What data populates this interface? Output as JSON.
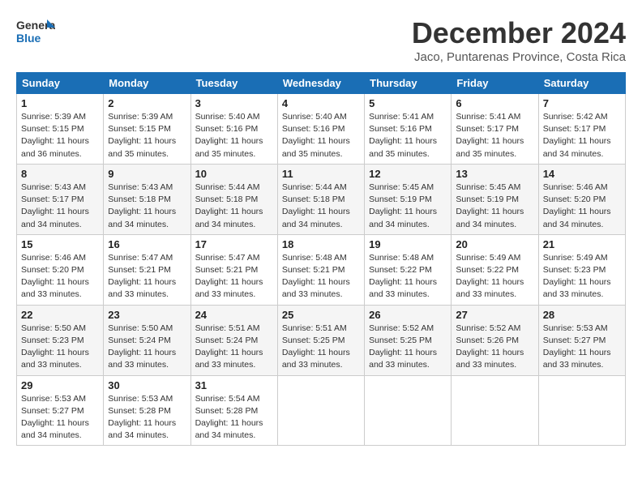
{
  "header": {
    "logo": {
      "general": "General",
      "blue": "Blue"
    },
    "title": "December 2024",
    "subtitle": "Jaco, Puntarenas Province, Costa Rica"
  },
  "days_of_week": [
    "Sunday",
    "Monday",
    "Tuesday",
    "Wednesday",
    "Thursday",
    "Friday",
    "Saturday"
  ],
  "weeks": [
    [
      {
        "day": "1",
        "sunrise": "5:39 AM",
        "sunset": "5:15 PM",
        "daylight": "11 hours and 36 minutes."
      },
      {
        "day": "2",
        "sunrise": "5:39 AM",
        "sunset": "5:15 PM",
        "daylight": "11 hours and 35 minutes."
      },
      {
        "day": "3",
        "sunrise": "5:40 AM",
        "sunset": "5:16 PM",
        "daylight": "11 hours and 35 minutes."
      },
      {
        "day": "4",
        "sunrise": "5:40 AM",
        "sunset": "5:16 PM",
        "daylight": "11 hours and 35 minutes."
      },
      {
        "day": "5",
        "sunrise": "5:41 AM",
        "sunset": "5:16 PM",
        "daylight": "11 hours and 35 minutes."
      },
      {
        "day": "6",
        "sunrise": "5:41 AM",
        "sunset": "5:17 PM",
        "daylight": "11 hours and 35 minutes."
      },
      {
        "day": "7",
        "sunrise": "5:42 AM",
        "sunset": "5:17 PM",
        "daylight": "11 hours and 34 minutes."
      }
    ],
    [
      {
        "day": "8",
        "sunrise": "5:43 AM",
        "sunset": "5:17 PM",
        "daylight": "11 hours and 34 minutes."
      },
      {
        "day": "9",
        "sunrise": "5:43 AM",
        "sunset": "5:18 PM",
        "daylight": "11 hours and 34 minutes."
      },
      {
        "day": "10",
        "sunrise": "5:44 AM",
        "sunset": "5:18 PM",
        "daylight": "11 hours and 34 minutes."
      },
      {
        "day": "11",
        "sunrise": "5:44 AM",
        "sunset": "5:18 PM",
        "daylight": "11 hours and 34 minutes."
      },
      {
        "day": "12",
        "sunrise": "5:45 AM",
        "sunset": "5:19 PM",
        "daylight": "11 hours and 34 minutes."
      },
      {
        "day": "13",
        "sunrise": "5:45 AM",
        "sunset": "5:19 PM",
        "daylight": "11 hours and 34 minutes."
      },
      {
        "day": "14",
        "sunrise": "5:46 AM",
        "sunset": "5:20 PM",
        "daylight": "11 hours and 34 minutes."
      }
    ],
    [
      {
        "day": "15",
        "sunrise": "5:46 AM",
        "sunset": "5:20 PM",
        "daylight": "11 hours and 33 minutes."
      },
      {
        "day": "16",
        "sunrise": "5:47 AM",
        "sunset": "5:21 PM",
        "daylight": "11 hours and 33 minutes."
      },
      {
        "day": "17",
        "sunrise": "5:47 AM",
        "sunset": "5:21 PM",
        "daylight": "11 hours and 33 minutes."
      },
      {
        "day": "18",
        "sunrise": "5:48 AM",
        "sunset": "5:21 PM",
        "daylight": "11 hours and 33 minutes."
      },
      {
        "day": "19",
        "sunrise": "5:48 AM",
        "sunset": "5:22 PM",
        "daylight": "11 hours and 33 minutes."
      },
      {
        "day": "20",
        "sunrise": "5:49 AM",
        "sunset": "5:22 PM",
        "daylight": "11 hours and 33 minutes."
      },
      {
        "day": "21",
        "sunrise": "5:49 AM",
        "sunset": "5:23 PM",
        "daylight": "11 hours and 33 minutes."
      }
    ],
    [
      {
        "day": "22",
        "sunrise": "5:50 AM",
        "sunset": "5:23 PM",
        "daylight": "11 hours and 33 minutes."
      },
      {
        "day": "23",
        "sunrise": "5:50 AM",
        "sunset": "5:24 PM",
        "daylight": "11 hours and 33 minutes."
      },
      {
        "day": "24",
        "sunrise": "5:51 AM",
        "sunset": "5:24 PM",
        "daylight": "11 hours and 33 minutes."
      },
      {
        "day": "25",
        "sunrise": "5:51 AM",
        "sunset": "5:25 PM",
        "daylight": "11 hours and 33 minutes."
      },
      {
        "day": "26",
        "sunrise": "5:52 AM",
        "sunset": "5:25 PM",
        "daylight": "11 hours and 33 minutes."
      },
      {
        "day": "27",
        "sunrise": "5:52 AM",
        "sunset": "5:26 PM",
        "daylight": "11 hours and 33 minutes."
      },
      {
        "day": "28",
        "sunrise": "5:53 AM",
        "sunset": "5:27 PM",
        "daylight": "11 hours and 33 minutes."
      }
    ],
    [
      {
        "day": "29",
        "sunrise": "5:53 AM",
        "sunset": "5:27 PM",
        "daylight": "11 hours and 34 minutes."
      },
      {
        "day": "30",
        "sunrise": "5:53 AM",
        "sunset": "5:28 PM",
        "daylight": "11 hours and 34 minutes."
      },
      {
        "day": "31",
        "sunrise": "5:54 AM",
        "sunset": "5:28 PM",
        "daylight": "11 hours and 34 minutes."
      },
      null,
      null,
      null,
      null
    ]
  ],
  "labels": {
    "sunrise": "Sunrise:",
    "sunset": "Sunset:",
    "daylight": "Daylight:"
  }
}
